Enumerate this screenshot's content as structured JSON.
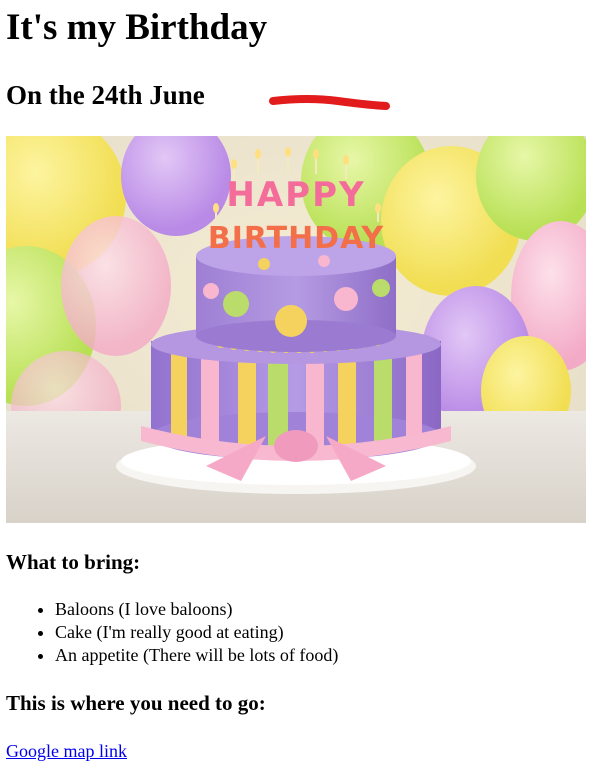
{
  "page": {
    "title": "It's my Birthday",
    "subtitle": "On the 24th June"
  },
  "image": {
    "cake_text_line1": "HAPPY",
    "cake_text_line2": "BIRTHDAY"
  },
  "bring": {
    "heading": "What to bring:",
    "items": [
      "Baloons (I love baloons)",
      "Cake (I'm really good at eating)",
      "An appetite (There will be lots of food)"
    ]
  },
  "directions": {
    "heading": "This is where you need to go:",
    "link_label": "Google map link"
  },
  "colors": {
    "link": "#0000ee",
    "annotation_mark": "#e21c1c"
  }
}
